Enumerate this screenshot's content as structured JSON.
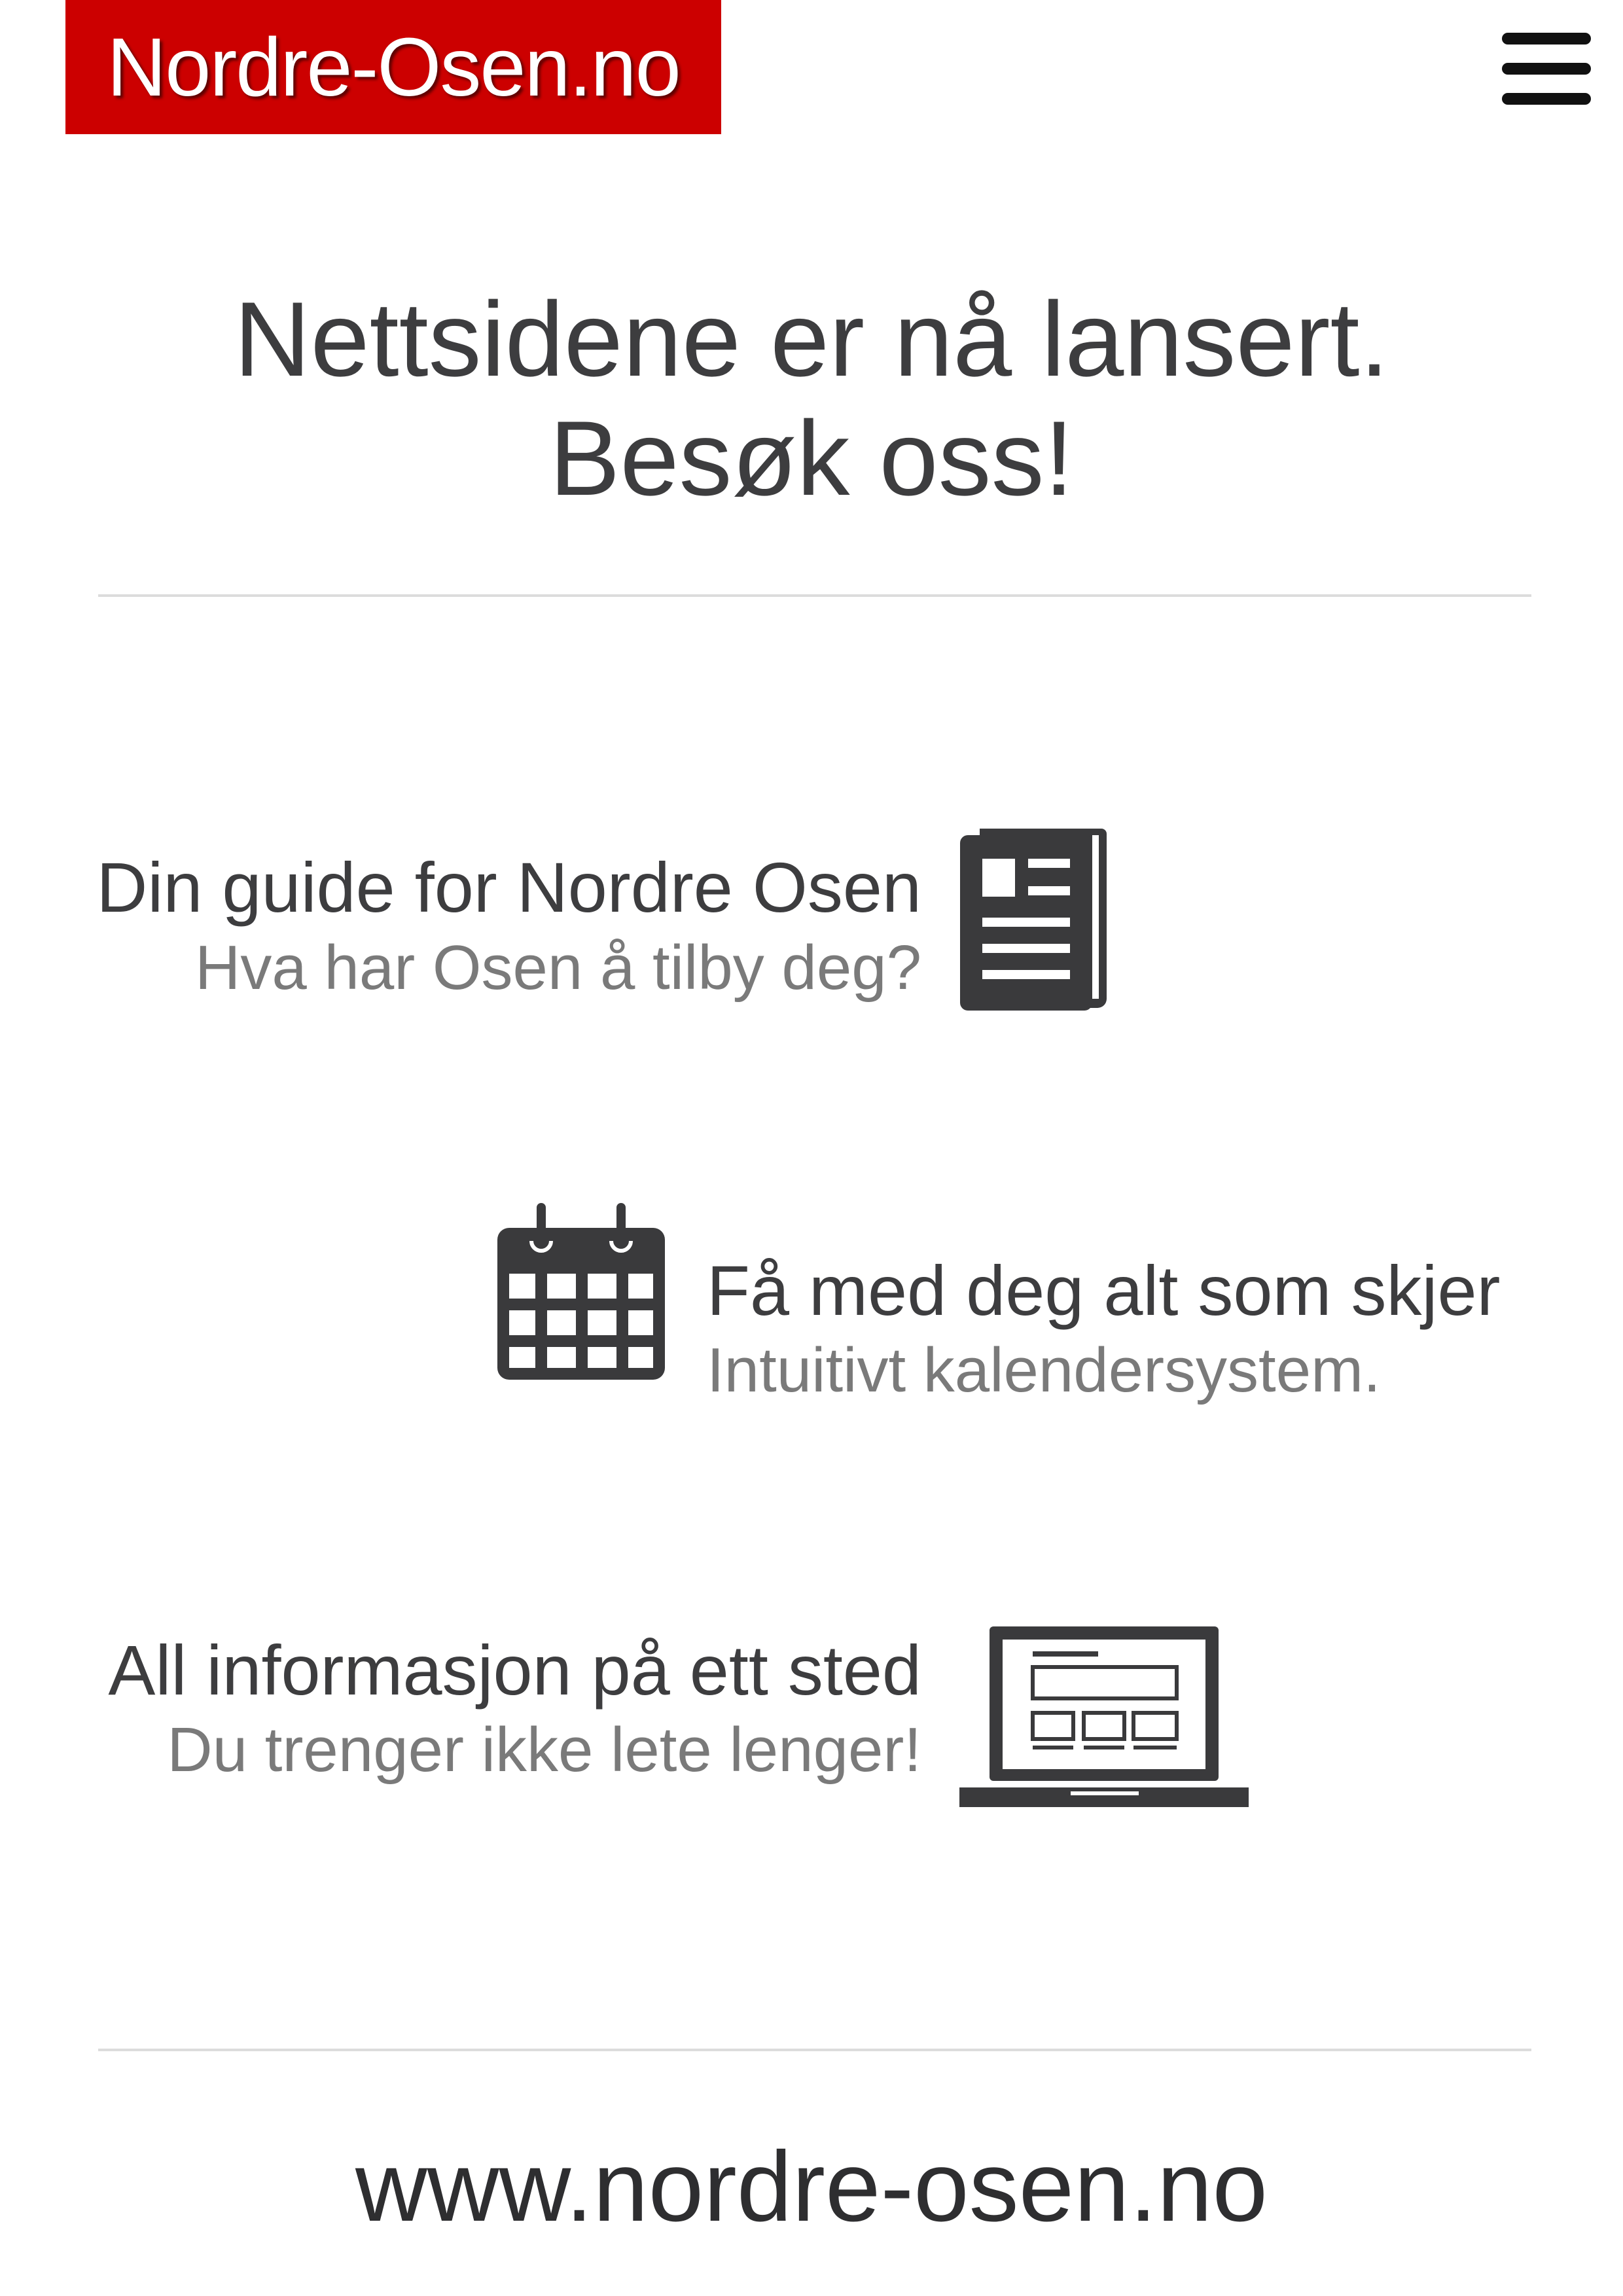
{
  "header": {
    "logo_text": "Nordre-Osen.no",
    "brand_color": "#cc0000",
    "menu_icon": "hamburger-menu-icon"
  },
  "hero": {
    "line1": "Nettsidene er nå lansert.",
    "line2": "Besøk oss!"
  },
  "features": [
    {
      "title": "Din guide for Nordre Osen",
      "subtitle": "Hva har Osen å tilby deg?",
      "icon": "newspaper-icon"
    },
    {
      "title": "Få med deg alt som skjer",
      "subtitle": "Intuitivt kalendersystem.",
      "icon": "calendar-icon"
    },
    {
      "title": "All informasjon på ett sted",
      "subtitle": "Du trenger ikke lete lenger!",
      "icon": "laptop-icon"
    }
  ],
  "footer": {
    "url": "www.nordre-osen.no"
  }
}
